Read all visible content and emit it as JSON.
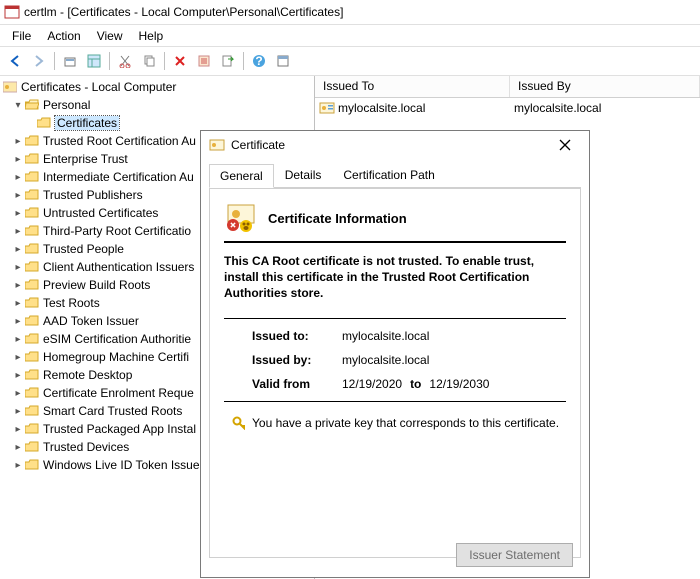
{
  "window": {
    "title": "certlm - [Certificates - Local Computer\\Personal\\Certificates]"
  },
  "menu": {
    "file": "File",
    "action": "Action",
    "view": "View",
    "help": "Help"
  },
  "tree": {
    "root": "Certificates - Local Computer",
    "personal": "Personal",
    "certs": "Certificates",
    "items": [
      "Trusted Root Certification Au",
      "Enterprise Trust",
      "Intermediate Certification Au",
      "Trusted Publishers",
      "Untrusted Certificates",
      "Third-Party Root Certificatio",
      "Trusted People",
      "Client Authentication Issuers",
      "Preview Build Roots",
      "Test Roots",
      "AAD Token Issuer",
      "eSIM Certification Authoritie",
      "Homegroup Machine Certifi",
      "Remote Desktop",
      "Certificate Enrolment Reque",
      "Smart Card Trusted Roots",
      "Trusted Packaged App Instal",
      "Trusted Devices",
      "Windows Live ID Token Issue"
    ]
  },
  "list": {
    "col1": "Issued To",
    "col2": "Issued By",
    "row": {
      "to": "mylocalsite.local",
      "by": "mylocalsite.local"
    }
  },
  "dialog": {
    "title": "Certificate",
    "tabs": {
      "general": "General",
      "details": "Details",
      "path": "Certification Path"
    },
    "heading": "Certificate Information",
    "warning": "This CA Root certificate is not trusted. To enable trust, install this certificate in the Trusted Root Certification Authorities store.",
    "issued_to_label": "Issued to:",
    "issued_to": "mylocalsite.local",
    "issued_by_label": "Issued by:",
    "issued_by": "mylocalsite.local",
    "valid_from_label": "Valid from",
    "valid_from": "12/19/2020",
    "valid_to_label": "to",
    "valid_to": "12/19/2030",
    "key_note": "You have a private key that corresponds to this certificate.",
    "issuer_btn": "Issuer Statement"
  }
}
